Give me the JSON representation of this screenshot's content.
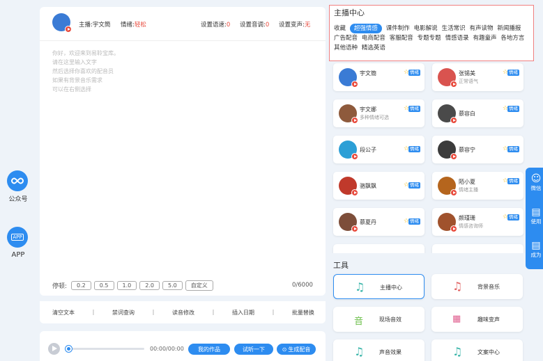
{
  "left_rail": {
    "wechat_label": "公众号",
    "app_label": "APP",
    "app_badge": "APP"
  },
  "editor": {
    "anchor_label": "主播:宇文簡",
    "emotion_label": "情绪:",
    "emotion_value": "轻松",
    "speed_label": "设置语速:",
    "speed_value": "0",
    "pitch_label": "设置音调:",
    "pitch_value": "0",
    "voice_change_label": "设置变声:",
    "voice_change_value": "无",
    "placeholder_lines": [
      "你好，欢迎来到易聆宝库。",
      "请在这里输入文字",
      "然后选择你喜欢的配音员",
      "如果有背景音乐需求",
      "可以在右侧选择"
    ],
    "pause_label": "停顿:",
    "pause_options": [
      "0.2",
      "0.5",
      "1.0",
      "2.0",
      "5.0",
      "自定义"
    ],
    "char_count": "0/6000",
    "ops": [
      "清空文本",
      "禁词查询",
      "读音修改",
      "插入日期",
      "批量替换"
    ],
    "ops_sep": "|"
  },
  "player": {
    "time": "00:00/00:00",
    "progress": 0,
    "my_works": "我的作品",
    "try_listen": "试听一下",
    "generate": "生成配音"
  },
  "anchor_center": {
    "title": "主播中心",
    "categories": [
      {
        "label": "收藏",
        "active": false
      },
      {
        "label": "超强情感",
        "active": true
      },
      {
        "label": "课件制作",
        "active": false
      },
      {
        "label": "电影解说",
        "active": false
      },
      {
        "label": "生活常识",
        "active": false
      },
      {
        "label": "有声读物",
        "active": false
      },
      {
        "label": "新闻播报",
        "active": false
      },
      {
        "label": "广告配音",
        "active": false
      },
      {
        "label": "电商配音",
        "active": false
      },
      {
        "label": "客服配音",
        "active": false
      },
      {
        "label": "专题专题",
        "active": false
      },
      {
        "label": "情感语录",
        "active": false
      },
      {
        "label": "有趣童声",
        "active": false
      },
      {
        "label": "各地方言",
        "active": false
      },
      {
        "label": "其他语种",
        "active": false
      },
      {
        "label": "精选英语",
        "active": false
      }
    ],
    "tag_label": "情绪",
    "anchors": [
      {
        "name": "宇文簡",
        "sub": "",
        "color": "#3a7bd5"
      },
      {
        "name": "张锡美",
        "sub": "正常语气",
        "color": "#d9534f"
      },
      {
        "name": "宇文娜",
        "sub": "多种情绪可选",
        "color": "#8e5a3c"
      },
      {
        "name": "慕容白",
        "sub": "",
        "color": "#4a4a4a"
      },
      {
        "name": "段公子",
        "sub": "",
        "color": "#2c9fd6"
      },
      {
        "name": "慕容宁",
        "sub": "",
        "color": "#3b3b3b"
      },
      {
        "name": "骆飘飘",
        "sub": "",
        "color": "#c0392b"
      },
      {
        "name": "陌小夏",
        "sub": "情绪主播",
        "color": "#b5651d"
      },
      {
        "name": "慕夏丹",
        "sub": "",
        "color": "#7d4e3a"
      },
      {
        "name": "颜瑾珊",
        "sub": "情感咨询师",
        "color": "#a0522d"
      }
    ]
  },
  "tools": {
    "title": "工具",
    "items": [
      {
        "label": "主播中心",
        "icon": "music-note-icon",
        "glyph": "♫",
        "selected": true
      },
      {
        "label": "背景音乐",
        "icon": "music-note-icon",
        "glyph": "♫",
        "selected": false
      },
      {
        "label": "现场音效",
        "icon": "sound-effect-icon",
        "glyph": "音",
        "selected": false
      },
      {
        "label": "趣味变声",
        "icon": "voice-change-icon",
        "glyph": "▦",
        "selected": false
      },
      {
        "label": "声音效果",
        "icon": "music-note-icon",
        "glyph": "♫",
        "selected": false
      },
      {
        "label": "文案中心",
        "icon": "music-note-icon",
        "glyph": "♫",
        "selected": false
      }
    ]
  },
  "float_bar": {
    "items": [
      "微信",
      "使用",
      "成为"
    ]
  },
  "colors": {
    "accent": "#2d8cf0",
    "highlight_border": "#f08080",
    "warning_text": "#e84a3c"
  }
}
